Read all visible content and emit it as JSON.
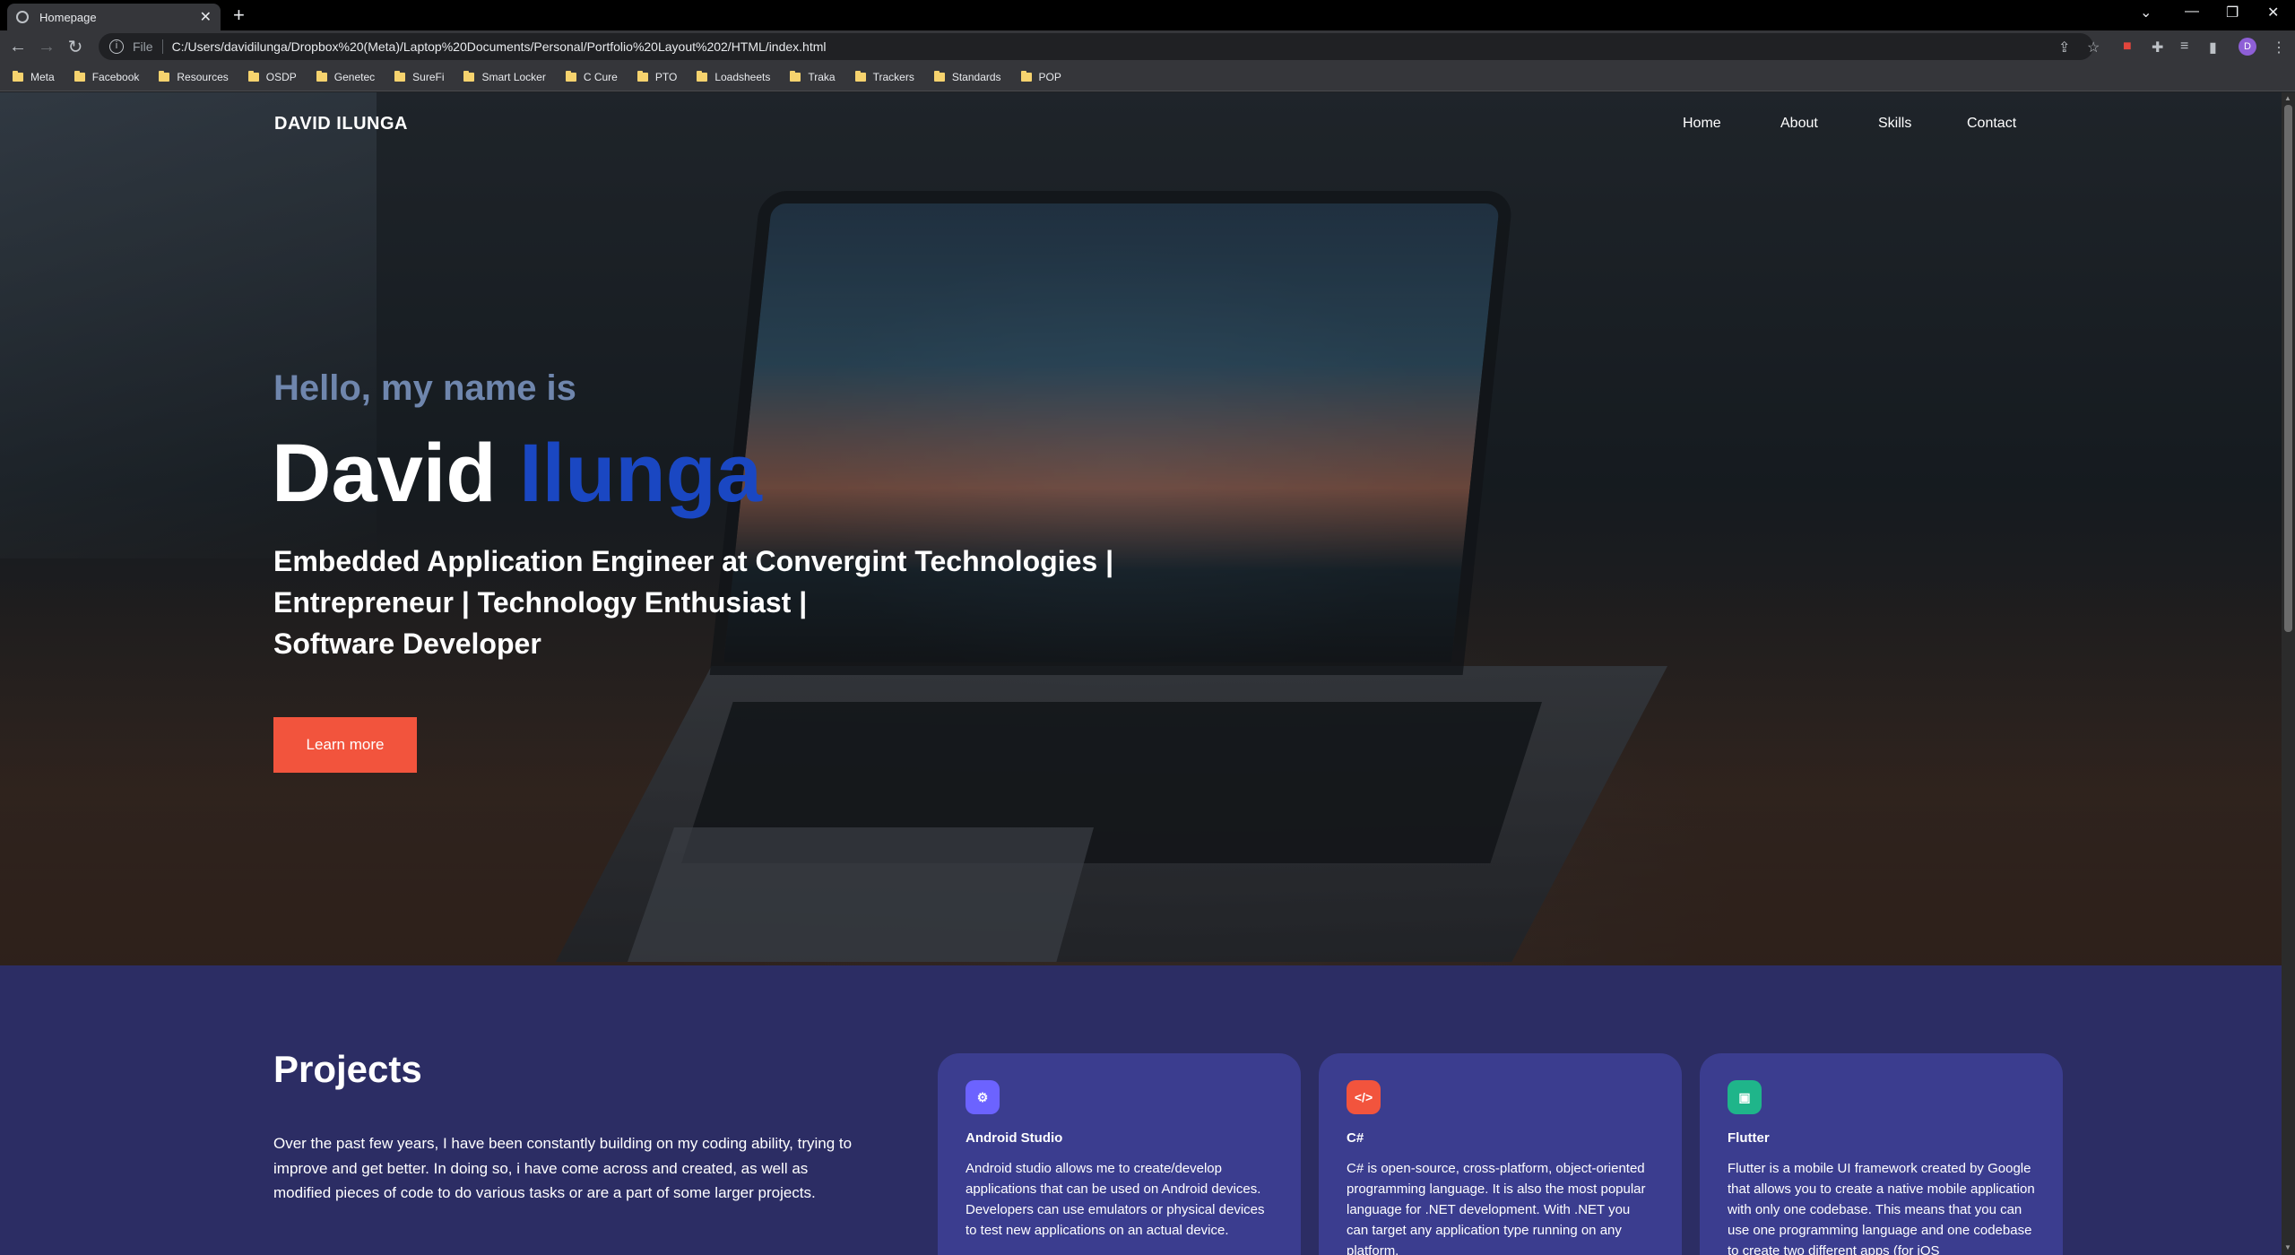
{
  "browser": {
    "tab_title": "Homepage",
    "scheme_label": "File",
    "url": "C:/Users/davidilunga/Dropbox%20(Meta)/Laptop%20Documents/Personal/Portfolio%20Layout%202/HTML/index.html",
    "profile_initial": "D",
    "bookmarks": [
      "Meta",
      "Facebook",
      "Resources",
      "OSDP",
      "Genetec",
      "SureFi",
      "Smart Locker",
      "C Cure",
      "PTO",
      "Loadsheets",
      "Traka",
      "Trackers",
      "Standards",
      "POP"
    ]
  },
  "header": {
    "brand": "DAVID ILUNGA",
    "nav": [
      "Home",
      "About",
      "Skills",
      "Contact"
    ]
  },
  "hero": {
    "greeting": "Hello, my name is",
    "first_name": "David",
    "last_name": "Ilunga",
    "tagline_lines": [
      "Embedded Application Engineer at Convergint Technologies |",
      "Entrepreneur | Technology Enthusiast |",
      "Software Developer"
    ],
    "cta_label": "Learn more"
  },
  "projects": {
    "title": "Projects",
    "description": "Over the past few years, I have been constantly building on my coding ability, trying to improve and get better. In doing so, i have come across and created, as well as modified pieces of code to do various tasks or are a part of some larger projects.",
    "cards": [
      {
        "title": "Android Studio",
        "icon": "gear-icon",
        "icon_color": "#6c63ff",
        "text": "Android studio allows me to create/develop applications that can be used on Android devices. Developers can use emulators or physical devices to test new applications on an actual device."
      },
      {
        "title": "C#",
        "icon": "code-icon",
        "icon_color": "#f2543d",
        "text": "C# is open-source, cross-platform, object-oriented programming language. It is also the most popular language for .NET development. With .NET you can target any application type running on any platform."
      },
      {
        "title": "Flutter",
        "icon": "document-icon",
        "icon_color": "#1fb58a",
        "text": "Flutter is a mobile UI framework created by Google that allows you to create a native mobile application with only one codebase. This means that you can use one programming language and one codebase to create two different apps (for iOS"
      }
    ]
  },
  "colors": {
    "accent_blue": "#1a47c2",
    "cta": "#f2543d",
    "projects_bg": "#2c2d64",
    "card_bg": "#3b3d8f"
  }
}
